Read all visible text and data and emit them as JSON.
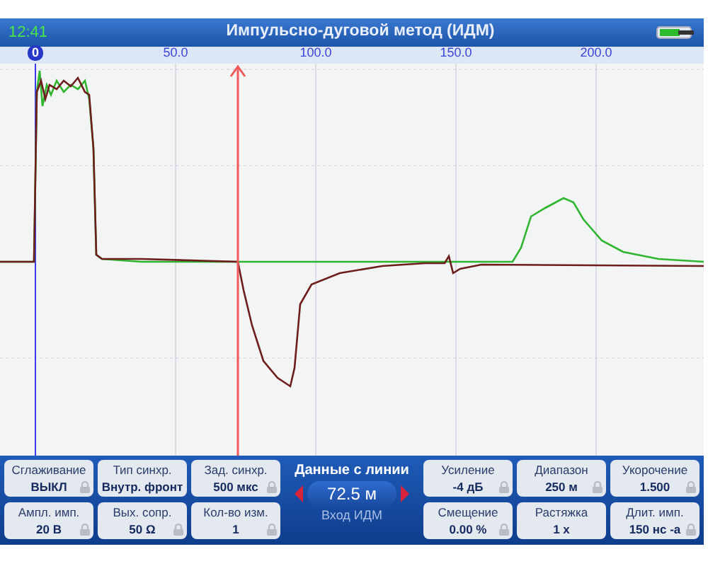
{
  "status": {
    "time": "12:41",
    "title": "Импульсно-дуговой метод (ИДМ)"
  },
  "ruler": {
    "labels": [
      "0",
      "50.0",
      "100.0",
      "150.0",
      "200.0"
    ]
  },
  "left_params": [
    {
      "label": "Сглаживание",
      "value": "ВЫКЛ",
      "locked": true
    },
    {
      "label": "Тип синхр.",
      "value": "Внутр. фронт",
      "locked": false
    },
    {
      "label": "Зад. синхр.",
      "value": "500 мкс",
      "locked": true
    },
    {
      "label": "Ампл. имп.",
      "value": "20 В",
      "locked": true
    },
    {
      "label": "Вых. сопр.",
      "value": "50 Ω",
      "locked": true
    },
    {
      "label": "Кол-во изм.",
      "value": "1",
      "locked": true
    }
  ],
  "center": {
    "title": "Данные с линии",
    "value": "72.5 м",
    "source": "Вход ИДМ"
  },
  "right_params": [
    {
      "label": "Усиление",
      "value": "-4 дБ",
      "locked": true
    },
    {
      "label": "Диапазон",
      "value": "250 м",
      "locked": true
    },
    {
      "label": "Укорочение",
      "value": "1.500",
      "locked": true
    },
    {
      "label": "Смещение",
      "value": "0.00 %",
      "locked": true
    },
    {
      "label": "Растяжка",
      "value": "1 х",
      "locked": false
    },
    {
      "label": "Длит. имп.",
      "value": "150 нс -а",
      "locked": true
    }
  ]
}
